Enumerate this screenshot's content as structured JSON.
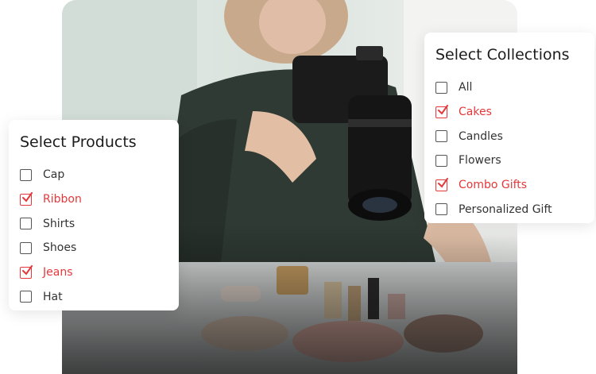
{
  "colors": {
    "accent": "#e5383b",
    "text": "#333333",
    "card_bg": "#ffffff"
  },
  "photo": {
    "icon": "photo-woman-camera"
  },
  "products": {
    "title": "Select Products",
    "items": [
      {
        "label": "Cap",
        "checked": false
      },
      {
        "label": "Ribbon",
        "checked": true
      },
      {
        "label": "Shirts",
        "checked": false
      },
      {
        "label": "Shoes",
        "checked": false
      },
      {
        "label": "Jeans",
        "checked": true
      },
      {
        "label": "Hat",
        "checked": false
      }
    ]
  },
  "collections": {
    "title": "Select Collections",
    "items": [
      {
        "label": "All",
        "checked": false
      },
      {
        "label": "Cakes",
        "checked": true
      },
      {
        "label": "Candles",
        "checked": false
      },
      {
        "label": "Flowers",
        "checked": false
      },
      {
        "label": "Combo Gifts",
        "checked": true
      },
      {
        "label": "Personalized Gift",
        "checked": false
      }
    ]
  }
}
